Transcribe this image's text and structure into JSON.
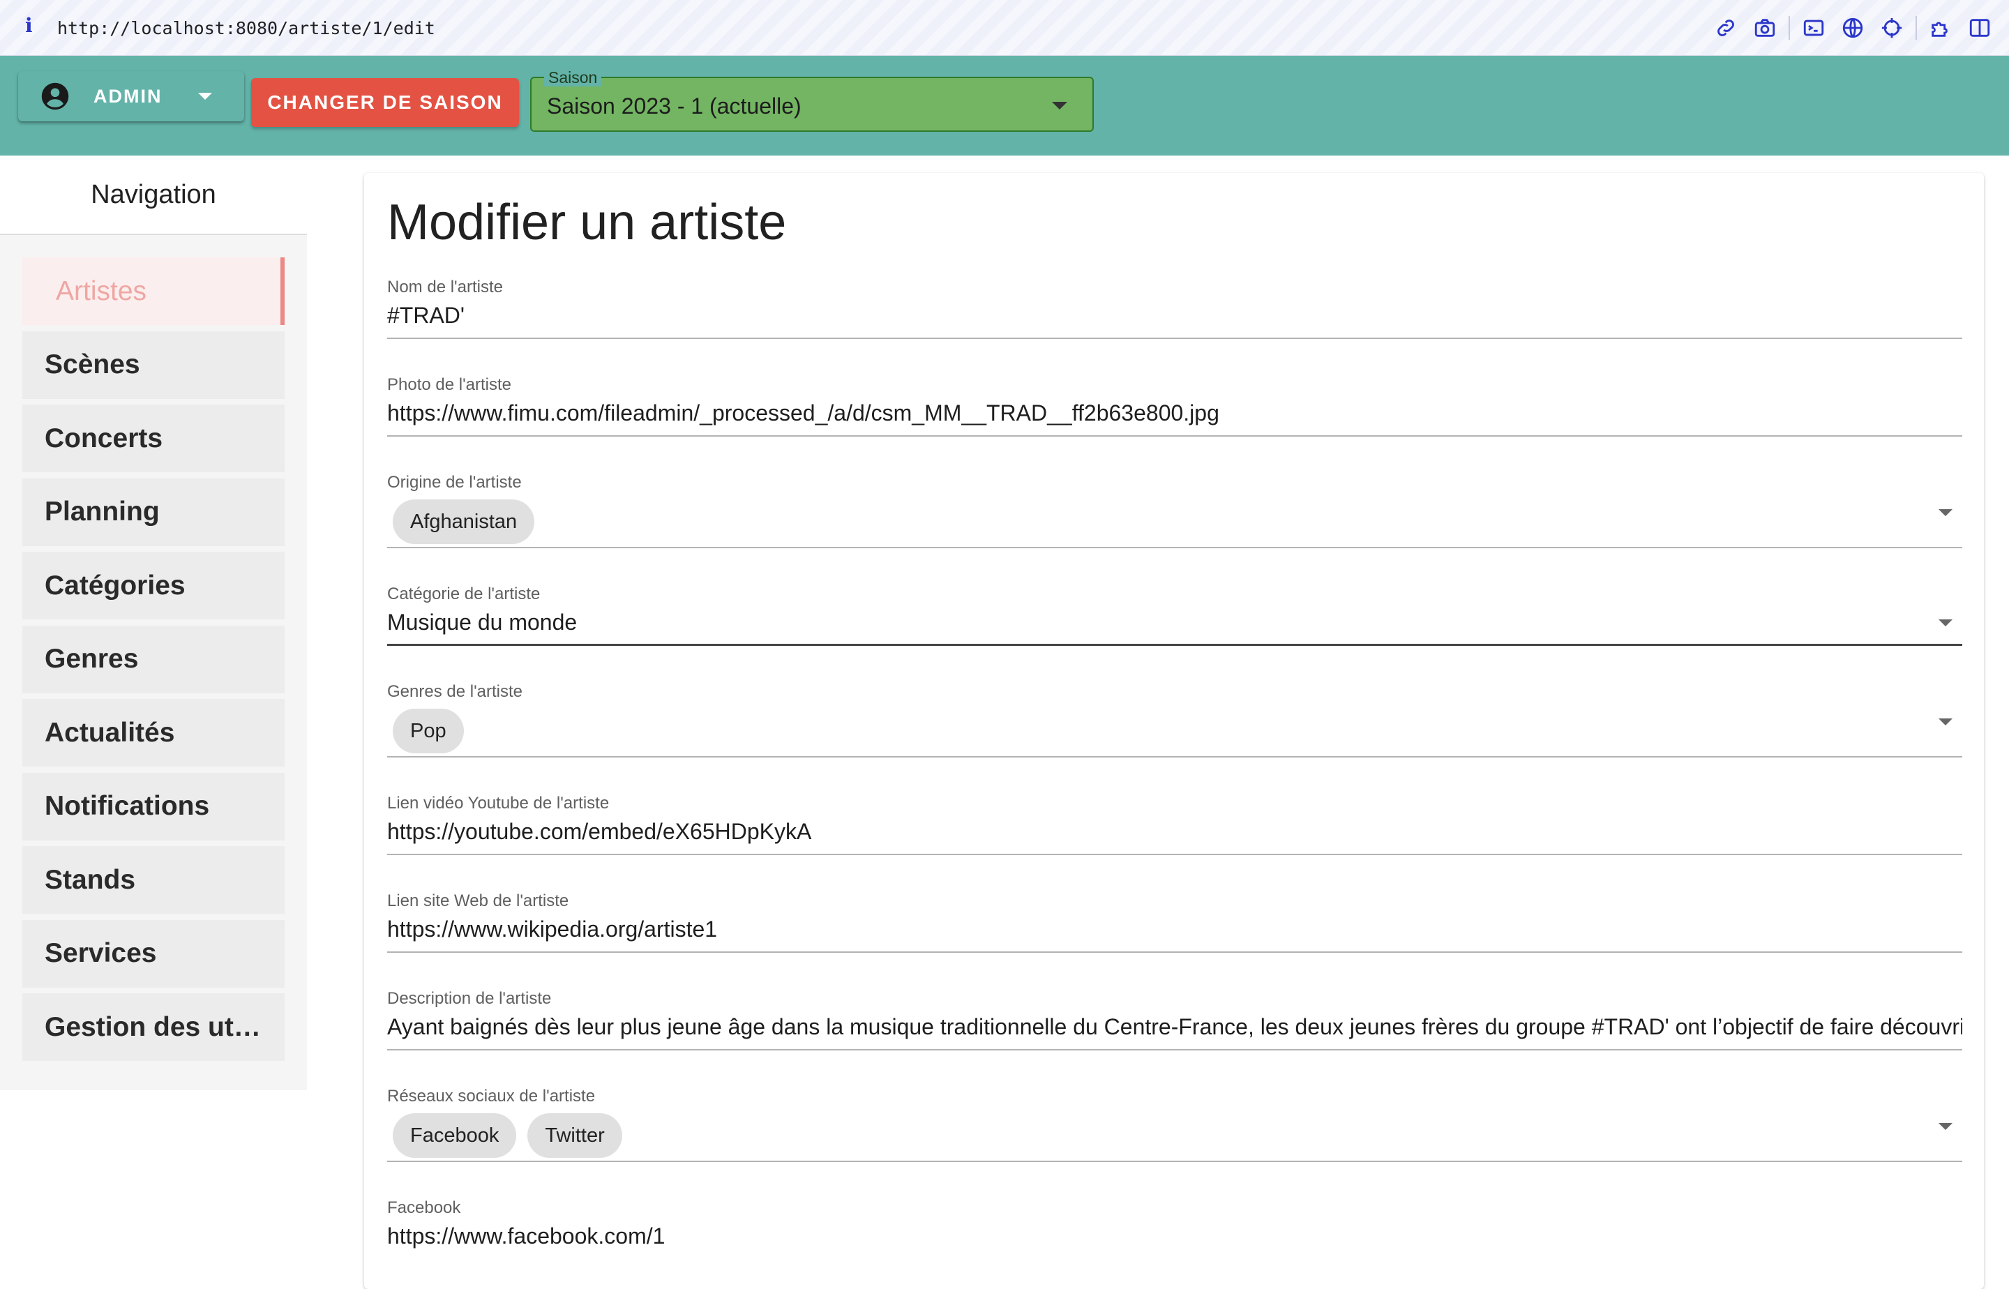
{
  "browser": {
    "info_glyph": "i",
    "url": "http://localhost:8080/artiste/1/edit",
    "tools": [
      "link-icon",
      "camera-icon",
      "terminal-icon",
      "globe-icon",
      "crosshair-icon",
      "extension-icon",
      "split-view-icon"
    ]
  },
  "appbar": {
    "user_label": "ADMIN",
    "change_season_label": "CHANGER DE SAISON",
    "season_field_label": "Saison",
    "season_value": "Saison 2023 - 1 (actuelle)",
    "colors": {
      "bar": "#63b3a9",
      "change_season": "#e35243",
      "season_select": "#73b562"
    }
  },
  "sidebar": {
    "title": "Navigation",
    "items": [
      {
        "label": "Artistes",
        "active": true
      },
      {
        "label": "Scènes"
      },
      {
        "label": "Concerts"
      },
      {
        "label": "Planning"
      },
      {
        "label": "Catégories"
      },
      {
        "label": "Genres"
      },
      {
        "label": "Actualités"
      },
      {
        "label": "Notifications"
      },
      {
        "label": "Stands"
      },
      {
        "label": "Services"
      },
      {
        "label": "Gestion des uti..."
      }
    ]
  },
  "form": {
    "title": "Modifier un artiste",
    "name": {
      "label": "Nom de l'artiste",
      "value": "#TRAD'"
    },
    "photo": {
      "label": "Photo de l'artiste",
      "value": "https://www.fimu.com/fileadmin/_processed_/a/d/csm_MM__TRAD__ff2b63e800.jpg"
    },
    "origin": {
      "label": "Origine de l'artiste",
      "chips": [
        "Afghanistan"
      ]
    },
    "category": {
      "label": "Catégorie de l'artiste",
      "value": "Musique du monde"
    },
    "genres": {
      "label": "Genres de l'artiste",
      "chips": [
        "Pop"
      ]
    },
    "youtube": {
      "label": "Lien vidéo Youtube de l'artiste",
      "value": "https://youtube.com/embed/eX65HDpKykA"
    },
    "website": {
      "label": "Lien site Web de l'artiste",
      "value": "https://www.wikipedia.org/artiste1"
    },
    "description": {
      "label": "Description de l'artiste",
      "value": "Ayant baignés dès leur plus jeune âge dans la musique traditionnelle du Centre-France, les deux jeunes frères du groupe #TRAD' ont l’objectif de faire découvrir d"
    },
    "socials": {
      "label": "Réseaux sociaux de l'artiste",
      "chips": [
        "Facebook",
        "Twitter"
      ]
    },
    "facebook": {
      "label": "Facebook",
      "value": "https://www.facebook.com/1"
    }
  }
}
